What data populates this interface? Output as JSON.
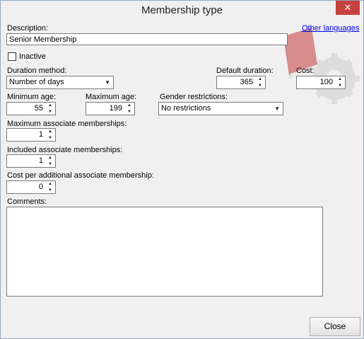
{
  "window": {
    "title": "Membership type",
    "close_glyph": "✕"
  },
  "description": {
    "label": "Description:",
    "value": "Senior Membership",
    "other_languages_link": "Other languages"
  },
  "inactive": {
    "label": "Inactive",
    "checked": false
  },
  "duration_method": {
    "label": "Duration method:",
    "value": "Number of days"
  },
  "default_duration": {
    "label": "Default duration:",
    "value": "365"
  },
  "cost": {
    "label": "Cost:",
    "value": "100"
  },
  "minimum_age": {
    "label": "Minimum age:",
    "value": "55"
  },
  "maximum_age": {
    "label": "Maximum age:",
    "value": "199"
  },
  "gender_restrictions": {
    "label": "Gender restrictions:",
    "value": "No restrictions"
  },
  "max_associate": {
    "label": "Maximum associate memberships:",
    "value": "1"
  },
  "included_associate": {
    "label": "Included associate memberships:",
    "value": "1"
  },
  "cost_per_additional": {
    "label": "Cost per additional associate membership:",
    "value": "0"
  },
  "comments": {
    "label": "Comments:",
    "value": ""
  },
  "buttons": {
    "close": "Close"
  },
  "icons": {
    "spin_up": "▲",
    "spin_down": "▼",
    "dropdown": "▼",
    "decoration": "book-gear-icon"
  },
  "colors": {
    "close_red": "#c7413e",
    "link_blue": "#0000ee",
    "book_red": "#c94a4a"
  }
}
